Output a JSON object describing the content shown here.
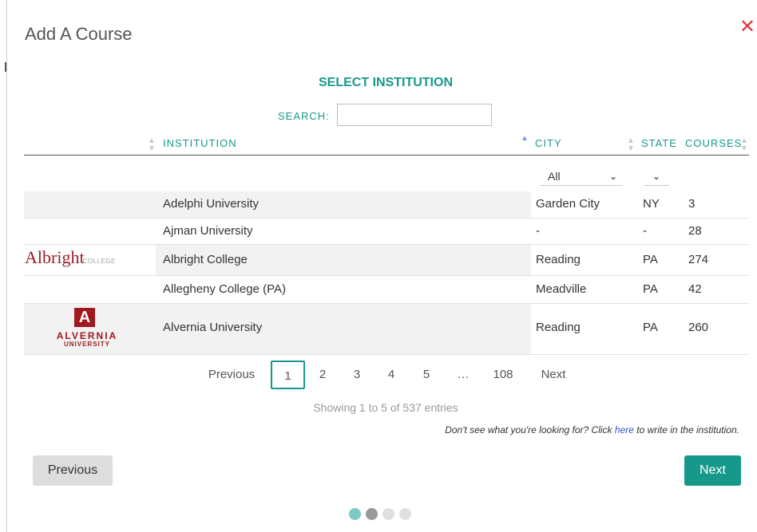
{
  "modal": {
    "title": "Add A Course",
    "close_glyph": "✕",
    "section_title": "SELECT INSTITUTION"
  },
  "search": {
    "label": "SEARCH:",
    "value": "",
    "placeholder": ""
  },
  "table": {
    "columns": [
      {
        "key": "institution",
        "label": "INSTITUTION",
        "sort": "none"
      },
      {
        "key": "city",
        "label": "CITY",
        "sort": "ascending"
      },
      {
        "key": "state",
        "label": "STATE",
        "sort": "none"
      },
      {
        "key": "courses",
        "label": "COURSES",
        "sort": "none"
      }
    ],
    "filters": {
      "city": "All",
      "state": ""
    },
    "rows": [
      {
        "logo": "",
        "institution": "Adelphi University",
        "city": "Garden City",
        "state": "NY",
        "courses": "3"
      },
      {
        "logo": "",
        "institution": "Ajman University",
        "city": "-",
        "state": "-",
        "courses": "28"
      },
      {
        "logo": "albright-logo",
        "logo_text": "Albright",
        "logo_sub": "COLLEGE",
        "institution": "Albright College",
        "city": "Reading",
        "state": "PA",
        "courses": "274"
      },
      {
        "logo": "",
        "institution": "Allegheny College (PA)",
        "city": "Meadville",
        "state": "PA",
        "courses": "42"
      },
      {
        "logo": "alvernia-logo",
        "logo_letter": "A",
        "logo_text": "ALVERNIA",
        "logo_sub": "UNIVERSITY",
        "institution": "Alvernia University",
        "city": "Reading",
        "state": "PA",
        "courses": "260"
      }
    ]
  },
  "pagination": {
    "previous": "Previous",
    "pages": [
      "1",
      "2",
      "3",
      "4",
      "5",
      "…",
      "108"
    ],
    "active": "1",
    "next": "Next",
    "showing": "Showing 1 to 5 of 537 entries"
  },
  "write_in": {
    "prefix": "Don't see what you're looking for? Click ",
    "link": "here",
    "suffix": " to write in the institution."
  },
  "footer": {
    "previous_label": "Previous",
    "next_label": "Next"
  },
  "steps": {
    "total": 4,
    "current": 1,
    "active_colors": [
      "#7cc8c3",
      "#999999"
    ],
    "inactive_color": "#e0e0e0"
  },
  "colors": {
    "accent": "#16998a",
    "close": "#e0393e",
    "link": "#2a58c8",
    "row_shade": "#f2f2f2"
  }
}
